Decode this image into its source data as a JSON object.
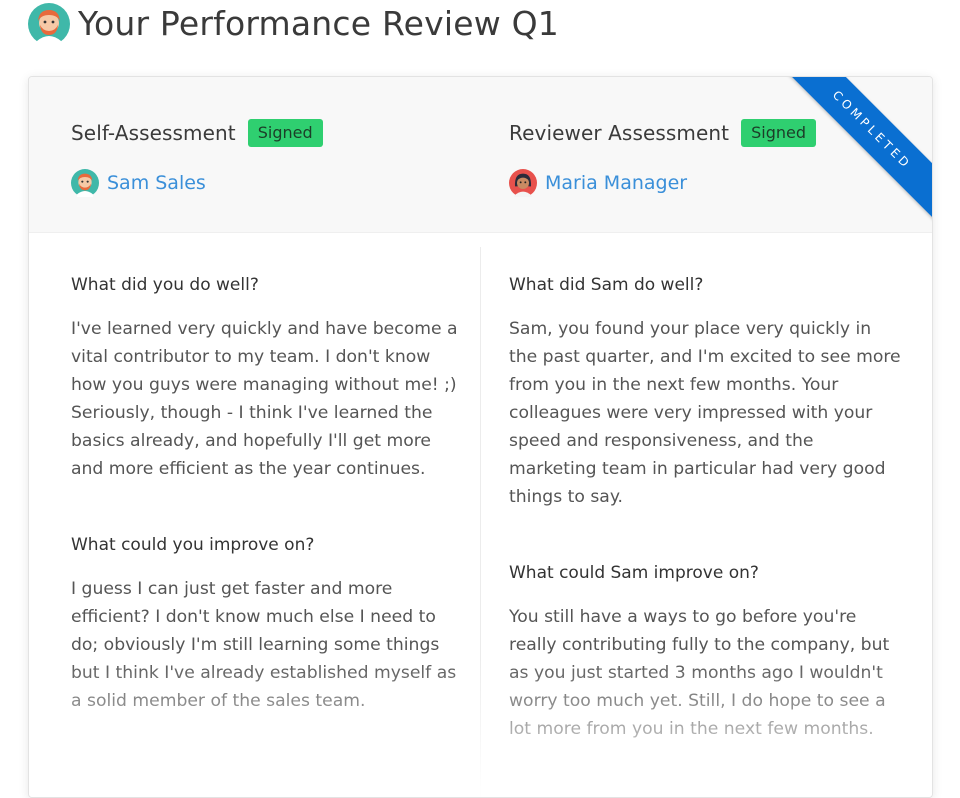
{
  "page": {
    "title": "Your Performance Review Q1",
    "avatar_icon": "sam-avatar-icon"
  },
  "self_assessment": {
    "heading": "Self-Assessment",
    "status": "Signed",
    "person": "Sam Sales",
    "questions": [
      {
        "question": "What did you do well?",
        "answer": "I've learned very quickly and have become a vital contributor to my team. I don't know how you guys were managing without me! ;) Seriously, though - I think I've learned the basics already, and hopefully I'll get more and more efficient as the year continues."
      },
      {
        "question": "What could you improve on?",
        "answer": "I guess I can just get faster and more efficient? I don't know much else I need to do; obviously I'm still learning some things but I think I've already established myself as a solid member of the sales team."
      }
    ]
  },
  "reviewer_assessment": {
    "heading": "Reviewer Assessment",
    "status": "Signed",
    "person": "Maria Manager",
    "questions": [
      {
        "question": "What did Sam do well?",
        "answer": "Sam, you found your place very quickly in the past quarter, and I'm excited to see more from you in the next few months. Your colleagues were very impressed with your speed and responsiveness, and the marketing team in particular had very good things to say."
      },
      {
        "question": "What could Sam improve on?",
        "answer": "You still have a ways to go before you're really contributing fully to the company, but as you just started 3 months ago I wouldn't worry too much yet. Still, I do hope to see a lot more from you in the next few months."
      }
    ]
  },
  "ribbon": {
    "label": "COMPLETED"
  },
  "colors": {
    "badge": "#2fcf70",
    "link": "#3a8fd9",
    "ribbon": "#0a6fd1",
    "header_bg": "#f8f8f8"
  }
}
